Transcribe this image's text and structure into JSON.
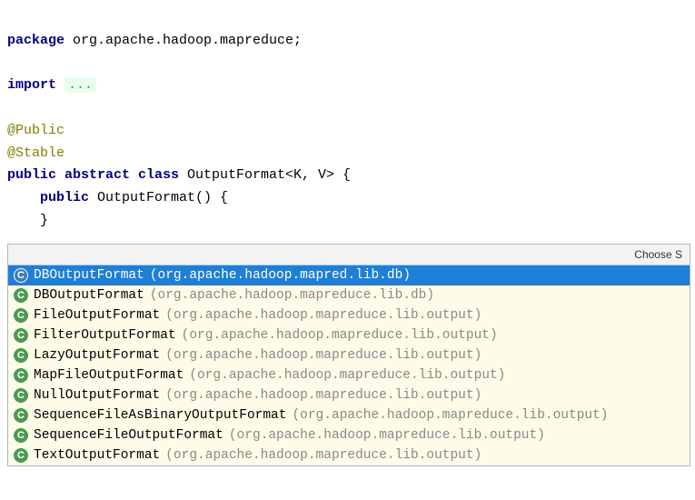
{
  "code": {
    "package_kw": "package",
    "package_name": " org.apache.hadoop.mapreduce;",
    "import_kw": "import",
    "import_fold": "...",
    "ann_public": "@Public",
    "ann_stable": "@Stable",
    "class_mods": "public abstract class",
    "class_name": " OutputFormat<K, V> {",
    "ctor_mods": "public",
    "ctor_sig": " OutputFormat() {",
    "ctor_close": "    }"
  },
  "popup": {
    "header": "Choose S",
    "items": [
      {
        "icon": "C",
        "name": "DBOutputFormat",
        "pkg": "(org.apache.hadoop.mapred.lib.db)",
        "selected": true
      },
      {
        "icon": "C",
        "name": "DBOutputFormat",
        "pkg": "(org.apache.hadoop.mapreduce.lib.db)",
        "selected": false
      },
      {
        "icon": "C",
        "name": "FileOutputFormat",
        "pkg": "(org.apache.hadoop.mapreduce.lib.output)",
        "selected": false
      },
      {
        "icon": "C",
        "name": "FilterOutputFormat",
        "pkg": "(org.apache.hadoop.mapreduce.lib.output)",
        "selected": false
      },
      {
        "icon": "C",
        "name": "LazyOutputFormat",
        "pkg": "(org.apache.hadoop.mapreduce.lib.output)",
        "selected": false
      },
      {
        "icon": "C",
        "name": "MapFileOutputFormat",
        "pkg": "(org.apache.hadoop.mapreduce.lib.output)",
        "selected": false
      },
      {
        "icon": "C",
        "name": "NullOutputFormat",
        "pkg": "(org.apache.hadoop.mapreduce.lib.output)",
        "selected": false
      },
      {
        "icon": "C",
        "name": "SequenceFileAsBinaryOutputFormat",
        "pkg": "(org.apache.hadoop.mapreduce.lib.output)",
        "selected": false
      },
      {
        "icon": "C",
        "name": "SequenceFileOutputFormat",
        "pkg": "(org.apache.hadoop.mapreduce.lib.output)",
        "selected": false
      },
      {
        "icon": "C",
        "name": "TextOutputFormat",
        "pkg": "(org.apache.hadoop.mapreduce.lib.output)",
        "selected": false
      }
    ]
  }
}
